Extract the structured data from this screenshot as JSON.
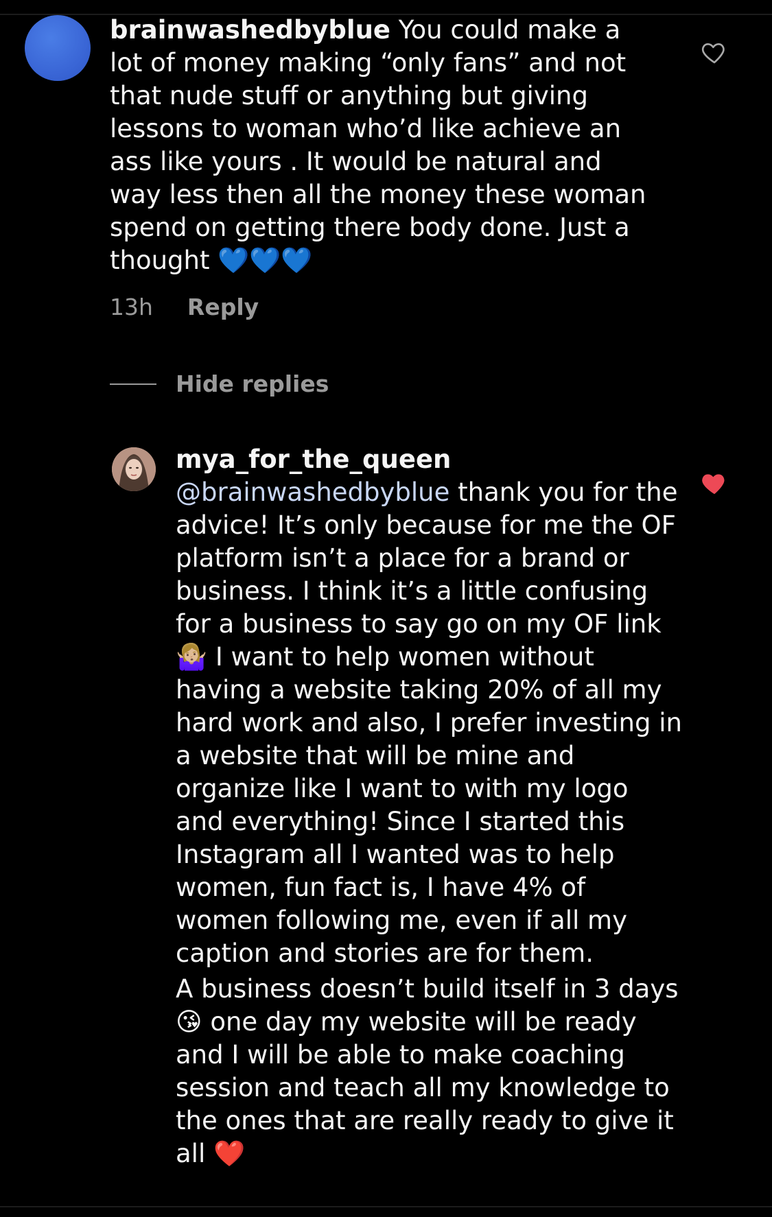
{
  "comment": {
    "username": "brainwashedbyblue",
    "text": " You could make a lot of money making “only fans” and not that nude stuff or anything but giving lessons to woman who’d like achieve an ass like yours . It would be natural and way less then all the money these woman spend on getting there body done. Just a thought ",
    "emojis": "💙💙💙",
    "time": "13h",
    "reply_label": "Reply",
    "liked": false
  },
  "hide_replies_label": "Hide replies",
  "reply": {
    "username": "mya_for_the_queen",
    "mention": "@brainwashedbyblue",
    "text_part1": " thank you for the advice! It’s only because for me the OF platform isn’t a place for a brand or business. I think it’s a little confusing for a business to say go on my OF link ",
    "emoji_shrug": "🤷🏼‍♀️",
    "text_part2": " I want to help women without having a website taking 20% of all my hard work and also, I prefer investing in a website that will be mine and organize like I want to with my logo and everything! Since I started this Instagram all I wanted was to help women, fun fact is, I have 4% of women following me, even if all my caption and stories are for them.",
    "text_part3": "A business doesn’t build itself in 3 days ",
    "emoji_kiss": "😘",
    "text_part4": " one day my website will be ready and I will be able to make coaching session and teach all my knowledge to the ones that are really ready to give it all ",
    "emoji_heart": "❤️",
    "liked": true
  },
  "icons": {
    "like_outline": "heart-outline-icon",
    "like_filled": "heart-filled-icon"
  },
  "colors": {
    "liked_red": "#ed4956",
    "muted_text": "#9a9a9a",
    "avatar_blue": "#3a66d6"
  }
}
